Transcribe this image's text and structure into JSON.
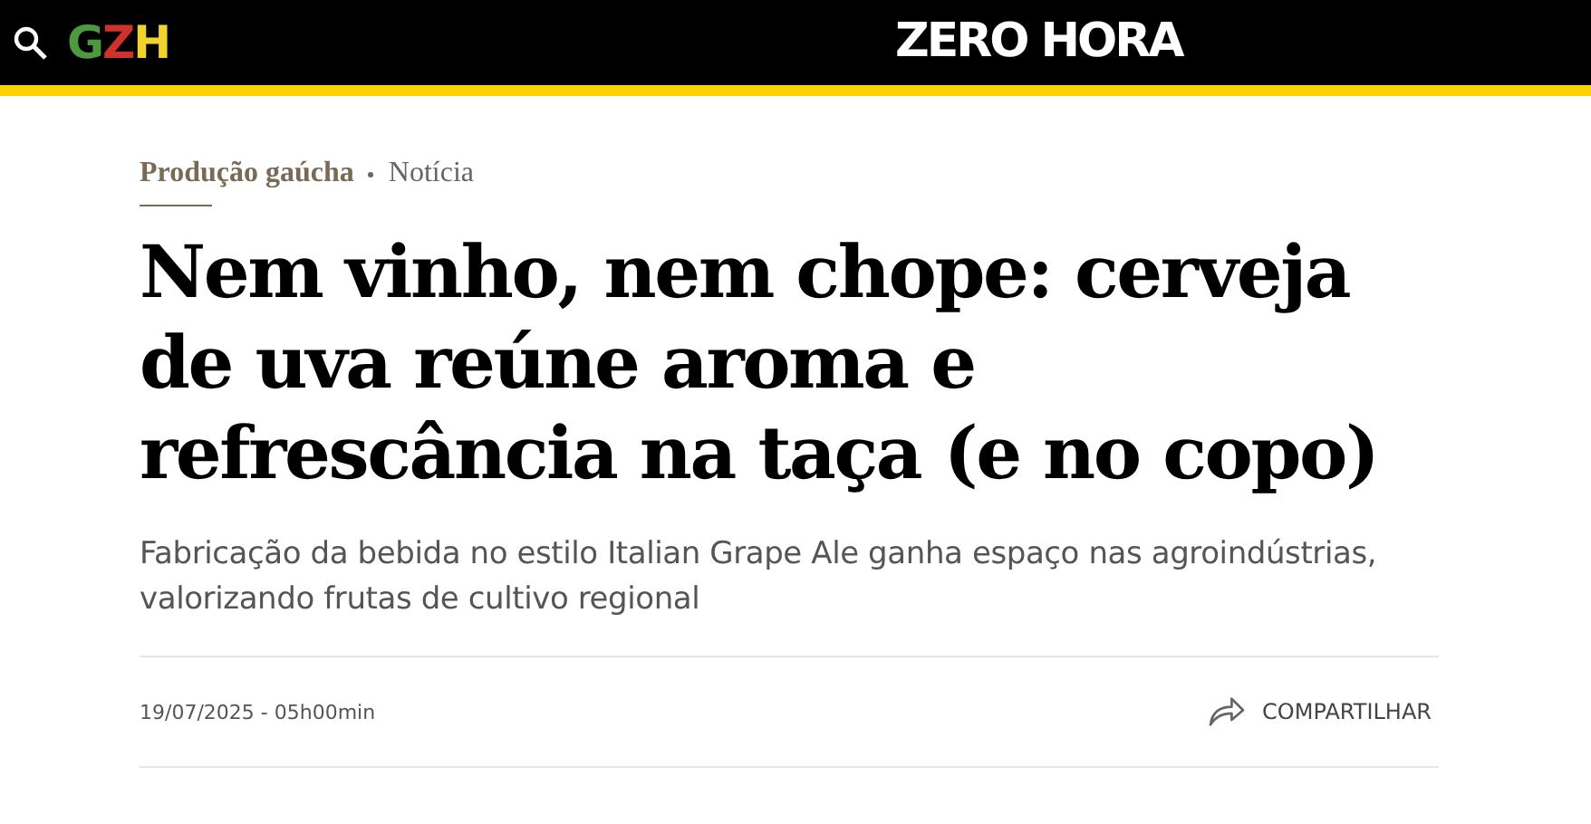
{
  "header": {
    "logo_letters": [
      {
        "text": "G",
        "color": "#4c9a3f"
      },
      {
        "text": "Z",
        "color": "#d0312d"
      },
      {
        "text": "H",
        "color": "#f2d22e"
      }
    ],
    "brand": "ZERO HORA"
  },
  "article": {
    "section": "Produção gaúcha",
    "kind_label": "Notícia",
    "title": "Nem vinho, nem chope: cerveja de uva reúne aroma e refrescância na taça (e no copo)",
    "subtitle": "Fabricação da bebida no estilo Italian Grape Ale ganha espaço nas agroindústrias, valorizando frutas de cultivo regional",
    "date": "19/07/2025 - 05h00min",
    "share": "COMPARTILHAR"
  }
}
